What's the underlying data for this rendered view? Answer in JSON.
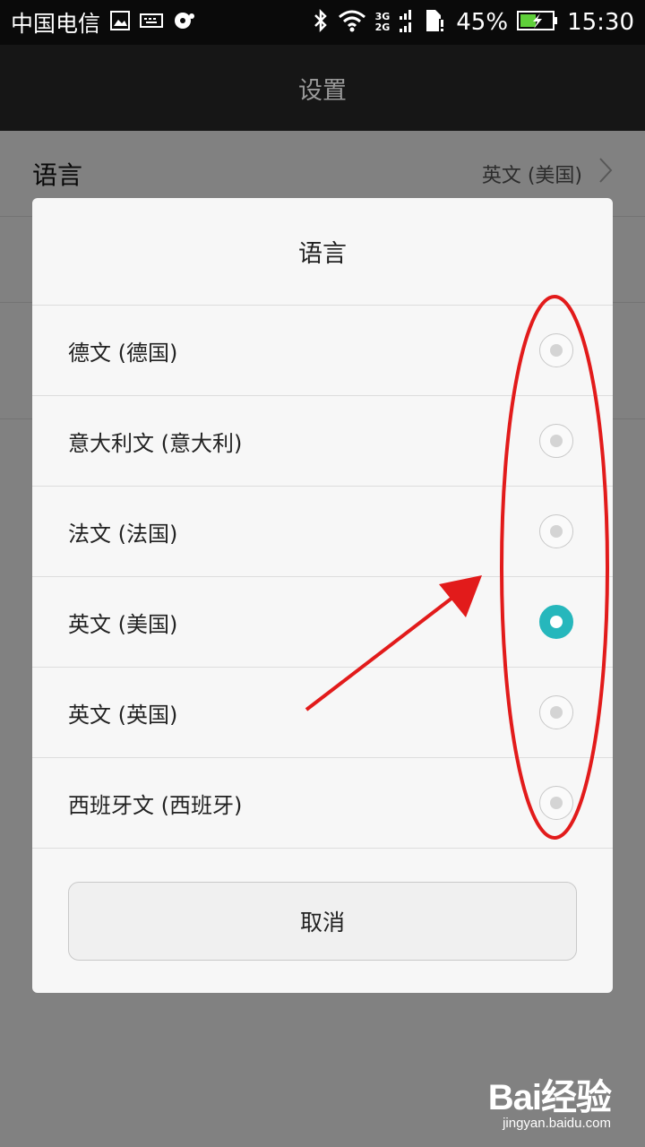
{
  "status_bar": {
    "carrier": "中国电信",
    "network_top": "3G",
    "network_bottom": "2G",
    "battery": "45%",
    "time": "15:30"
  },
  "title_bar": {
    "title": "设置"
  },
  "settings": {
    "rows": [
      {
        "label": "语言",
        "value": "英文 (美国)"
      },
      {
        "label": "",
        "value": ""
      },
      {
        "label": "",
        "value": ""
      }
    ]
  },
  "dialog": {
    "title": "语言",
    "options": [
      {
        "label": "德文 (德国)",
        "selected": false
      },
      {
        "label": "意大利文 (意大利)",
        "selected": false
      },
      {
        "label": "法文 (法国)",
        "selected": false
      },
      {
        "label": "英文 (美国)",
        "selected": true
      },
      {
        "label": "英文 (英国)",
        "selected": false
      },
      {
        "label": "西班牙文 (西班牙)",
        "selected": false
      }
    ],
    "cancel_label": "取消"
  },
  "colors": {
    "accent": "#26b7bc",
    "annotation": "#e21b1b"
  },
  "watermark": {
    "logo": "Bai经验",
    "url": "jingyan.baidu.com"
  }
}
